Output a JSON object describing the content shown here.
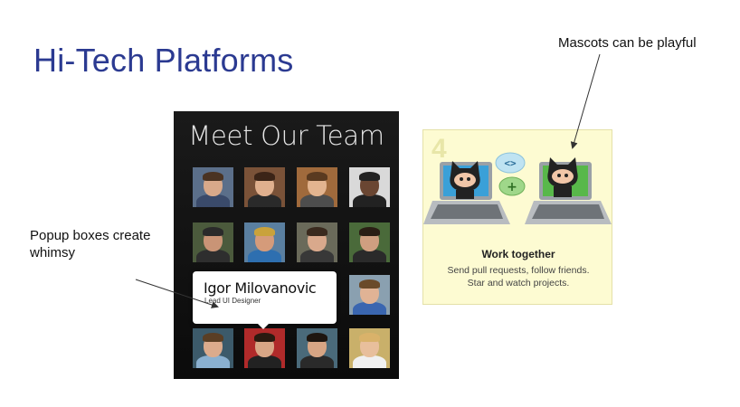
{
  "slide": {
    "title": "Hi-Tech Platforms",
    "callout_mascots": "Mascots can be playful",
    "callout_popup": "Popup boxes create whimsy"
  },
  "team_panel": {
    "title": "Meet Our Team",
    "popup": {
      "name": "Igor Milovanovic",
      "role": "Lead UI Designer"
    },
    "avatars": [
      {
        "bg": "#5b6f8a",
        "skin": "#d8a98a",
        "shirt": "#3a4a6a",
        "hair": "#4a3322"
      },
      {
        "bg": "#7a5238",
        "skin": "#e0b08e",
        "shirt": "#2a2a2a",
        "hair": "#3b2417"
      },
      {
        "bg": "#a06a3c",
        "skin": "#e3b48f",
        "shirt": "#4d4d4d",
        "hair": "#5a3a20"
      },
      {
        "bg": "#d9d9d9",
        "skin": "#6a4632",
        "shirt": "#222222",
        "hair": "#222222"
      },
      {
        "bg": "#4b5a3c",
        "skin": "#c99476",
        "shirt": "#2e2e2e",
        "hair": "#2a2a2a"
      },
      {
        "bg": "#5a7fa0",
        "skin": "#d59b7a",
        "shirt": "#2e6fb0",
        "hair": "#c9a23b"
      },
      {
        "bg": "#6a6a5a",
        "skin": "#d9a98c",
        "shirt": "#383838",
        "hair": "#3a2a1e"
      },
      {
        "bg": "#4a6a3a",
        "skin": "#cf9f80",
        "shirt": "#2a2a2a",
        "hair": "#2a1e14"
      },
      {
        "bg": "#8aa0b0",
        "skin": "#e0b395",
        "shirt": "#3a66b0",
        "hair": "#6a4a2a"
      },
      {
        "bg": "#3c5a6a",
        "skin": "#dcab8c",
        "shirt": "#8ab0d0",
        "hair": "#5a3e24"
      },
      {
        "bg": "#b02a2a",
        "skin": "#d8a686",
        "shirt": "#222222",
        "hair": "#2a1a10"
      },
      {
        "bg": "#4a6a7a",
        "skin": "#d7a584",
        "shirt": "#2a2a2a",
        "hair": "#1e1610"
      },
      {
        "bg": "#c9b06a",
        "skin": "#e8bf9c",
        "shirt": "#f0f0f0",
        "hair": "#d9b26a"
      }
    ]
  },
  "github_card": {
    "number": "4",
    "heading": "Work together",
    "line1": "Send pull requests, follow friends.",
    "line2": "Star and watch projects.",
    "bubble_code": "<>",
    "bubble_plus": "+"
  },
  "colors": {
    "title": "#2b3a91",
    "card_bg": "#fdfbd2",
    "panel_bg": "#111111",
    "bubble_blue": "#bfe3f2",
    "bubble_green": "#9fd78a",
    "screen_blue": "#3aa0d8",
    "screen_green": "#58b84a"
  }
}
